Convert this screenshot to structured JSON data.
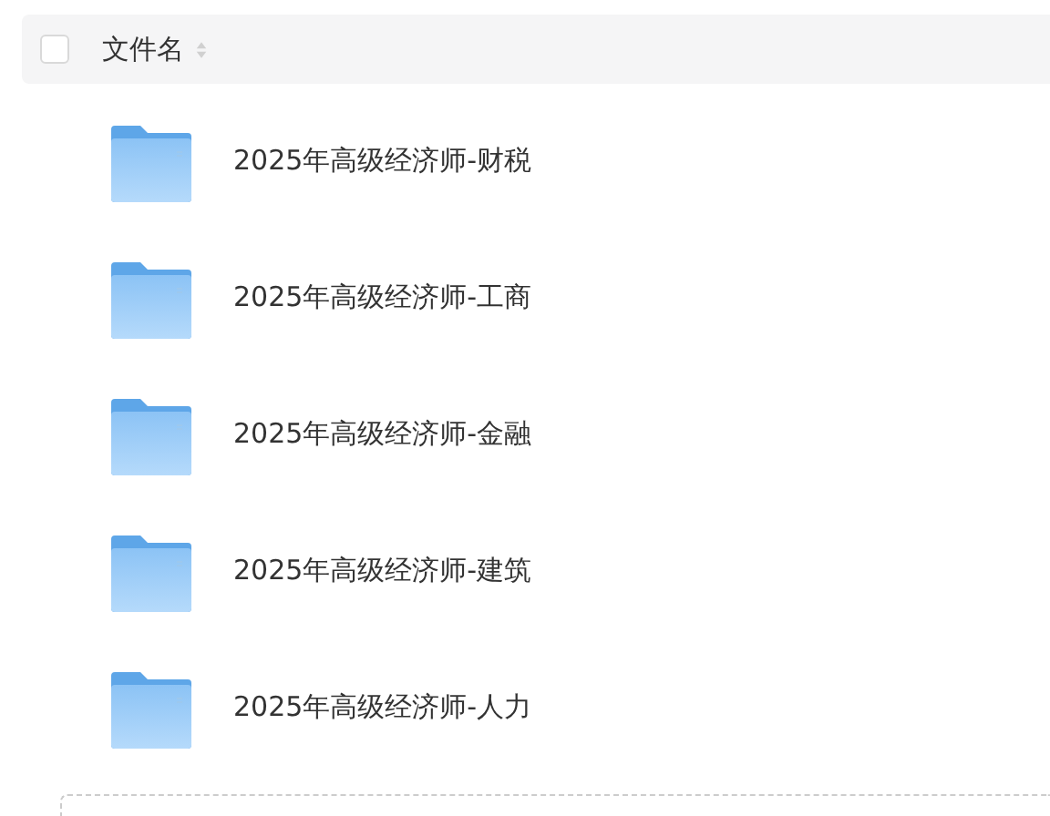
{
  "header": {
    "checked": false,
    "label": "文件名"
  },
  "files": [
    {
      "name": "2025年高级经济师-财税"
    },
    {
      "name": "2025年高级经济师-工商"
    },
    {
      "name": "2025年高级经济师-金融"
    },
    {
      "name": "2025年高级经济师-建筑"
    },
    {
      "name": "2025年高级经济师-人力"
    }
  ]
}
